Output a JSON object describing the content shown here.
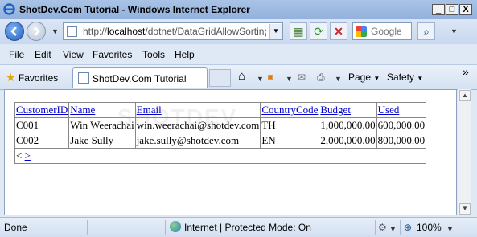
{
  "window": {
    "title": "ShotDev.Com Tutorial - Windows Internet Explorer",
    "minimize": "_",
    "maximize": "□",
    "close": "X"
  },
  "address_bar": {
    "url_prefix": "http://",
    "url_host": "localhost",
    "url_path": "/dotnet/DataGridAllowSortingAllo",
    "search_placeholder": "Google"
  },
  "menu": [
    "File",
    "Edit",
    "View",
    "Favorites",
    "Tools",
    "Help"
  ],
  "command_bar": {
    "favorites_label": "Favorites",
    "tab_title": "ShotDev.Com Tutorial",
    "page_label": "Page",
    "safety_label": "Safety",
    "overflow": "»"
  },
  "content": {
    "watermark": "SHOTDEV",
    "grid": {
      "headers": [
        "CustomerID",
        "Name",
        "Email",
        "CountryCode",
        "Budget",
        "Used"
      ],
      "rows": [
        [
          "C001",
          "Win Weerachai",
          "win.weerachai@shotdev.com",
          "TH",
          "1,000,000.00",
          "600,000.00"
        ],
        [
          "C002",
          "Jake Sully",
          "jake.sully@shotdev.com",
          "EN",
          "2,000,000.00",
          "800,000.00"
        ]
      ],
      "pager_prev": "<",
      "pager_next": ">"
    }
  },
  "status_bar": {
    "status_text": "Done",
    "zone_text": "Internet | Protected Mode: On",
    "zoom": "100%"
  }
}
